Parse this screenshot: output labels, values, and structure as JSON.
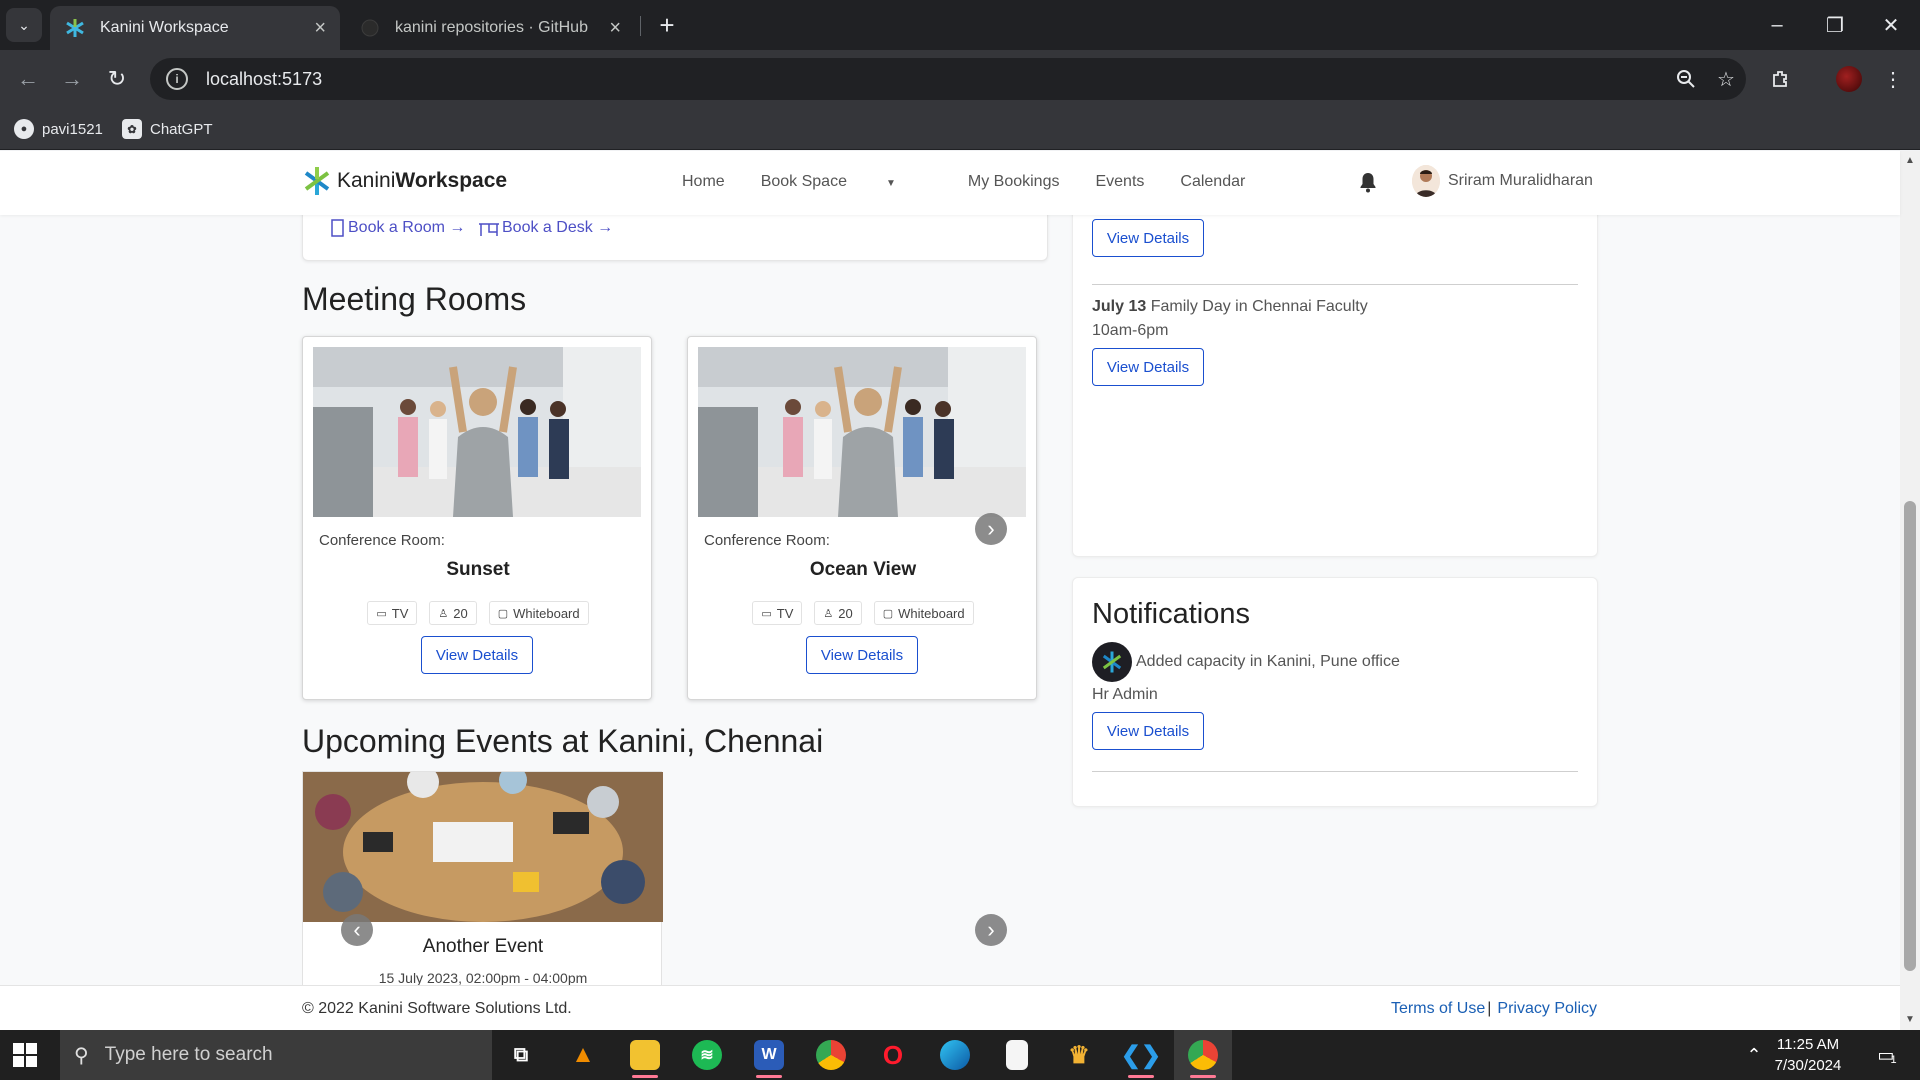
{
  "browser": {
    "tabs": [
      {
        "title": "Kanini Workspace",
        "active": true
      },
      {
        "title": "kanini repositories · GitHub",
        "active": false
      }
    ],
    "url": "localhost:5173",
    "bookmarks": [
      {
        "label": "pavi1521",
        "icon": "github-icon"
      },
      {
        "label": "ChatGPT",
        "icon": "chatgpt-icon"
      }
    ]
  },
  "app": {
    "brand_light": "Kanini",
    "brand_bold": "Workspace",
    "nav": {
      "home": "Home",
      "book_space": "Book Space",
      "my_bookings": "My Bookings",
      "events": "Events",
      "calendar": "Calendar"
    },
    "user_name": "Sriram Muralidharan"
  },
  "quick_links": {
    "room": "Book a Room →",
    "desk": "Book a Desk →"
  },
  "meeting_rooms": {
    "title": "Meeting Rooms",
    "rooms": [
      {
        "type_label": "Conference Room:",
        "name": "Sunset",
        "amenities": {
          "tv": "TV",
          "capacity": "20",
          "board": "Whiteboard"
        },
        "button": "View Details"
      },
      {
        "type_label": "Conference Room:",
        "name": "Ocean View",
        "amenities": {
          "tv": "TV",
          "capacity": "20",
          "board": "Whiteboard"
        },
        "button": "View Details"
      }
    ]
  },
  "upcoming_events": {
    "title": "Upcoming Events at Kanini, Chennai",
    "items": [
      {
        "title": "Another Event",
        "datetime": "15 July 2023, 02:00pm - 04:00pm"
      }
    ]
  },
  "side_events": {
    "top_button": "View Details",
    "items": [
      {
        "date": "July 13",
        "title": "Family Day in Chennai Faculty",
        "time": "10am-6pm",
        "button": "View Details"
      }
    ]
  },
  "notifications": {
    "title": "Notifications",
    "items": [
      {
        "message": "Added capacity in Kanini, Pune office",
        "sender": "Hr Admin",
        "button": "View Details"
      }
    ]
  },
  "footer": {
    "copyright": "© 2022 Kanini Software Solutions Ltd.",
    "terms": "Terms of Use",
    "separator": "|",
    "privacy": "Privacy Policy"
  },
  "taskbar": {
    "search_placeholder": "Type here to search",
    "time": "11:25 AM",
    "date": "7/30/2024",
    "notification_count": "1"
  },
  "colors": {
    "link_blue": "#1a4fcf",
    "quick_link": "#4d4fc5",
    "chrome_dark": "#202124",
    "chrome_mid": "#35363a"
  }
}
